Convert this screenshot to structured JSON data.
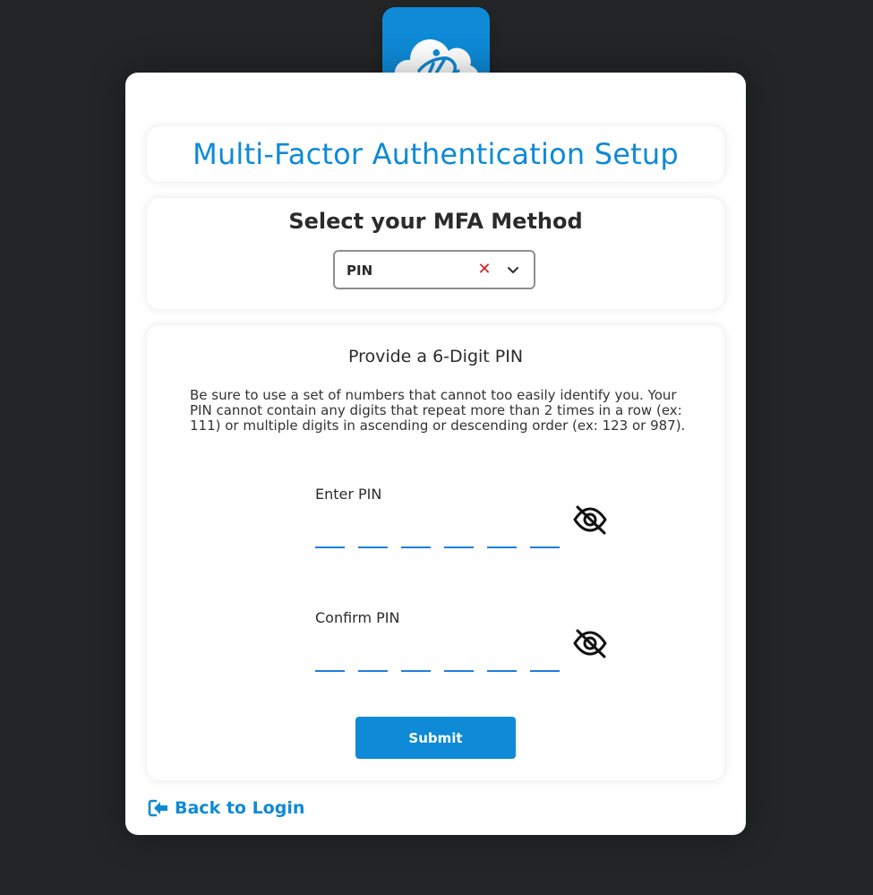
{
  "header": {
    "logo_icon": "cloud-person-logo-icon",
    "title": "Multi-Factor Authentication Setup"
  },
  "method": {
    "heading": "Select your MFA Method",
    "selected_value": "PIN",
    "clear_icon": "close-icon",
    "clear_glyph": "✕",
    "dropdown_icon": "chevron-down-icon"
  },
  "pin": {
    "heading": "Provide a 6-Digit PIN",
    "description": "Be sure to use a set of numbers that cannot too easily identify you. Your PIN cannot contain any digits that repeat more than 2 times in a row (ex: 111) or multiple digits in ascending or descending order (ex: 123 or 987).",
    "enter_label": "Enter PIN",
    "confirm_label": "Confirm PIN",
    "visibility_icon": "eye-off-icon",
    "submit_label": "Submit"
  },
  "footer": {
    "back_label": "Back to Login",
    "back_icon": "sign-out-arrow-icon"
  },
  "colors": {
    "background": "#242526",
    "accent": "#0e8ad6",
    "clear": "#d91e1e",
    "slot_underline": "#1f7de0"
  }
}
